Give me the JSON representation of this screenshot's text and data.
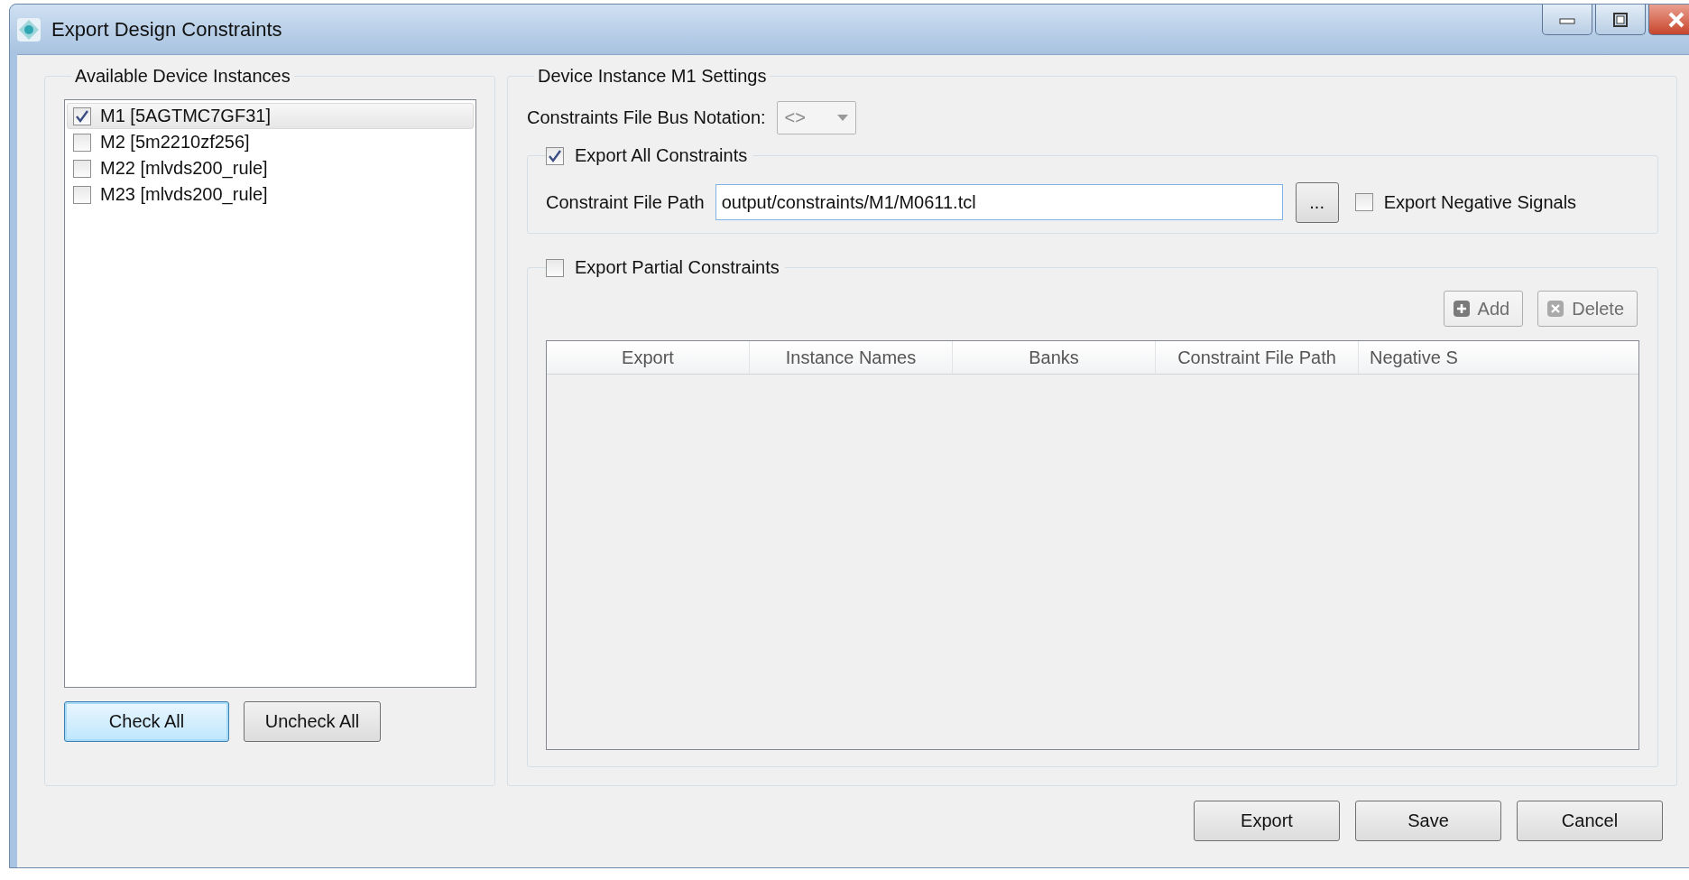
{
  "window": {
    "title": "Export Design Constraints"
  },
  "instances": {
    "title": "Available Device Instances",
    "items": [
      {
        "label": "M1 [5AGTMC7GF31]",
        "checked": true,
        "selected": true
      },
      {
        "label": "M2 [5m2210zf256]",
        "checked": false,
        "selected": false
      },
      {
        "label": "M22 [mlvds200_rule]",
        "checked": false,
        "selected": false
      },
      {
        "label": "M23 [mlvds200_rule]",
        "checked": false,
        "selected": false
      }
    ],
    "buttons": [
      {
        "label": "Check All",
        "focused": true
      },
      {
        "label": "Uncheck All",
        "focused": false
      }
    ]
  },
  "settings": {
    "title": "Device Instance M1 Settings",
    "bus_notation": {
      "label": "Constraints File Bus Notation:",
      "value": "<>",
      "disabled": true
    },
    "export_all": {
      "label": "Export All Constraints",
      "checked": true,
      "path_label": "Constraint File Path",
      "path_value": "output/constraints/M1/M0611.tcl",
      "browse": "...",
      "negative": {
        "label": "Export Negative Signals",
        "checked": false
      }
    },
    "export_partial": {
      "label": "Export Partial Constraints",
      "checked": false,
      "buttons": [
        {
          "label": "Add",
          "kind": "add",
          "disabled": true
        },
        {
          "label": "Delete",
          "kind": "delete",
          "disabled": true
        }
      ],
      "table": {
        "columns": [
          "Export",
          "Instance Names",
          "Banks",
          "Constraint File Path",
          "Negative S"
        ]
      }
    }
  },
  "footer_buttons": [
    "Export",
    "Save",
    "Cancel"
  ]
}
